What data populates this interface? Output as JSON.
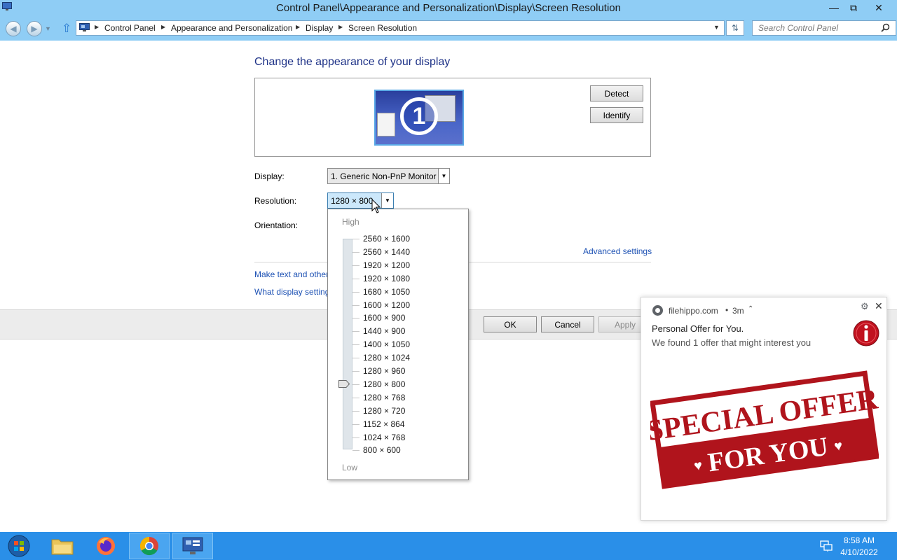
{
  "window": {
    "title": "Control Panel\\Appearance and Personalization\\Display\\Screen Resolution",
    "minimize_glyph": "—",
    "maximize_glyph": "⧉",
    "close_glyph": "✕"
  },
  "address_bar": {
    "breadcrumbs": [
      "Control Panel",
      "Appearance and Personalization",
      "Display",
      "Screen Resolution"
    ],
    "search_placeholder": "Search Control Panel"
  },
  "main": {
    "heading": "Change the appearance of your display",
    "monitor_number": "1",
    "detect_label": "Detect",
    "identify_label": "Identify",
    "display_label": "Display:",
    "display_value": "1. Generic Non-PnP Monitor",
    "resolution_label": "Resolution:",
    "resolution_value": "1280 × 800",
    "orientation_label": "Orientation:",
    "advanced_settings": "Advanced settings",
    "link_text_size": "Make text and other",
    "link_display_settings": "What display setting",
    "ok_label": "OK",
    "cancel_label": "Cancel",
    "apply_label": "Apply"
  },
  "resolution_dropdown": {
    "high_label": "High",
    "low_label": "Low",
    "options": [
      "2560 × 1600",
      "2560 × 1440",
      "1920 × 1200",
      "1920 × 1080",
      "1680 × 1050",
      "1600 × 1200",
      "1600 × 900",
      "1440 × 900",
      "1400 × 1050",
      "1280 × 1024",
      "1280 × 960",
      "1280 × 800",
      "1280 × 768",
      "1280 × 720",
      "1152 × 864",
      "1024 × 768",
      "800 × 600"
    ],
    "selected": "1280 × 800"
  },
  "notification": {
    "site": "filehippo.com",
    "separator": "•",
    "time": "3m",
    "title": "Personal Offer for You.",
    "body": "We found 1 offer that might interest you",
    "stamp_line1": "SPECIAL OFFER",
    "stamp_line2": "FOR YOU"
  },
  "taskbar": {
    "items": [
      "start-button",
      "file-explorer",
      "firefox",
      "chrome",
      "control-panel"
    ],
    "time": "8:58 AM",
    "date": "4/10/2022"
  },
  "colors": {
    "titlebar": "#8fcdf5",
    "taskbar": "#2a8fe8",
    "heading": "#1e3287",
    "link": "#1e52b4",
    "stamp_red": "#b0141c"
  }
}
